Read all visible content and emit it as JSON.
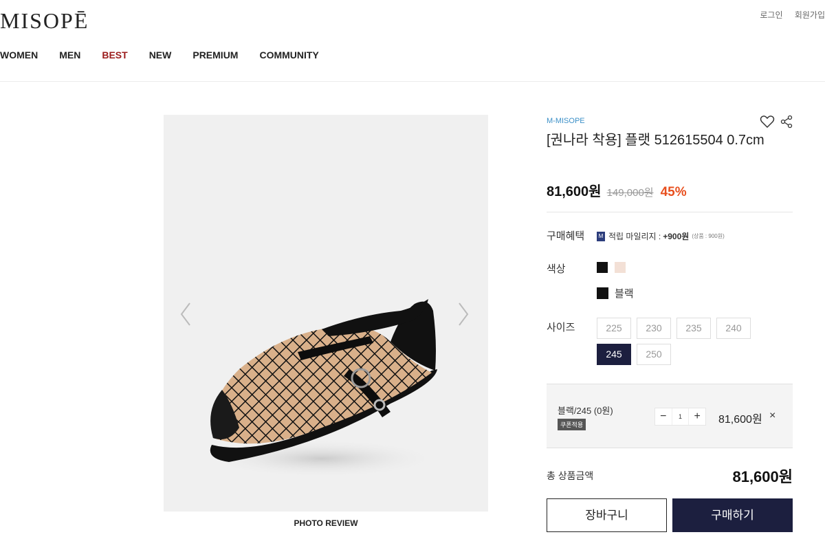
{
  "header": {
    "logo": "MISOPĒ",
    "login": "로그인",
    "signup": "회원가입",
    "nav": [
      "WOMEN",
      "MEN",
      "BEST",
      "NEW",
      "PREMIUM",
      "COMMUNITY"
    ]
  },
  "gallery": {
    "photo_review": "PHOTO REVIEW"
  },
  "product": {
    "brand": "M-MISOPE",
    "title": "[권나라 착용] 플랫 512615504 0.7cm",
    "price": "81,600원",
    "original_price": "149,000원",
    "discount": "45%",
    "benefit_label": "구매혜택",
    "benefit_badge": "M",
    "benefit_text": "적립 마일리지 :",
    "benefit_amount": "+900원",
    "benefit_note": "(상품 : 900원)",
    "color_label": "색상",
    "colors": [
      {
        "name": "블랙",
        "hex": "#111111"
      },
      {
        "name": "베이지",
        "hex": "#f3e0d6"
      }
    ],
    "selected_color": "블랙",
    "size_label": "사이즈",
    "sizes": [
      "225",
      "230",
      "235",
      "240",
      "245",
      "250"
    ],
    "selected_size": "245"
  },
  "option": {
    "name": "블랙/245 (0원)",
    "coupon": "쿠폰적용",
    "minus": "−",
    "qty": "1",
    "plus": "+",
    "price": "81,600원",
    "remove": "×"
  },
  "summary": {
    "total_label": "총 상품금액",
    "total": "81,600원",
    "cart": "장바구니",
    "buy": "구매하기"
  },
  "colors": {
    "accent_navy": "#1c1f3f",
    "discount": "#e8501f",
    "brand_link": "#3a8fc7",
    "best_nav": "#9b1b1b"
  }
}
